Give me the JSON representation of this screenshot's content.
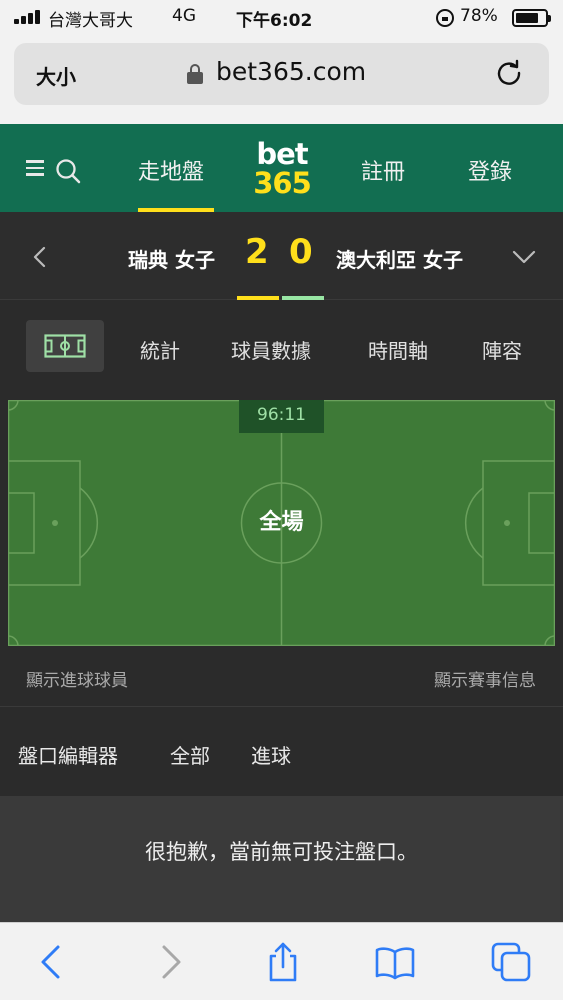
{
  "status_bar": {
    "carrier": "台灣大哥大",
    "network": "4G",
    "time": "下午6:02",
    "battery_percent": "78%",
    "battery_level": 0.78,
    "icons": [
      "signal-icon",
      "orientation-lock-icon",
      "battery-icon"
    ]
  },
  "browser": {
    "text_size_label": "大小",
    "url": "bet365.com",
    "icons": [
      "padlock-icon",
      "reload-icon"
    ]
  },
  "header": {
    "nav_live": "走地盤",
    "logo_top": "bet",
    "logo_bottom": "365",
    "nav_register": "註冊",
    "nav_login": "登錄",
    "accent_color": "#ffdf1b",
    "brand_color": "#126e51"
  },
  "match": {
    "home_team": "瑞典 女子",
    "home_score": "2",
    "away_score": "0",
    "away_team": "澳大利亞 女子"
  },
  "tabs": {
    "stats": "統計",
    "players": "球員數據",
    "timeline": "時間軸",
    "lineup": "陣容"
  },
  "pitch": {
    "clock": "96:11",
    "status": "全場",
    "show_scorers": "顯示進球球員",
    "show_info": "顯示賽事信息"
  },
  "markets": {
    "editor": "盤口編輯器",
    "all": "全部",
    "goals": "進球",
    "empty_message": "很抱歉，當前無可投注盤口。"
  },
  "toolbar": {
    "icons": [
      "back-icon",
      "forward-icon",
      "share-icon",
      "bookmarks-icon",
      "tabs-icon"
    ]
  }
}
